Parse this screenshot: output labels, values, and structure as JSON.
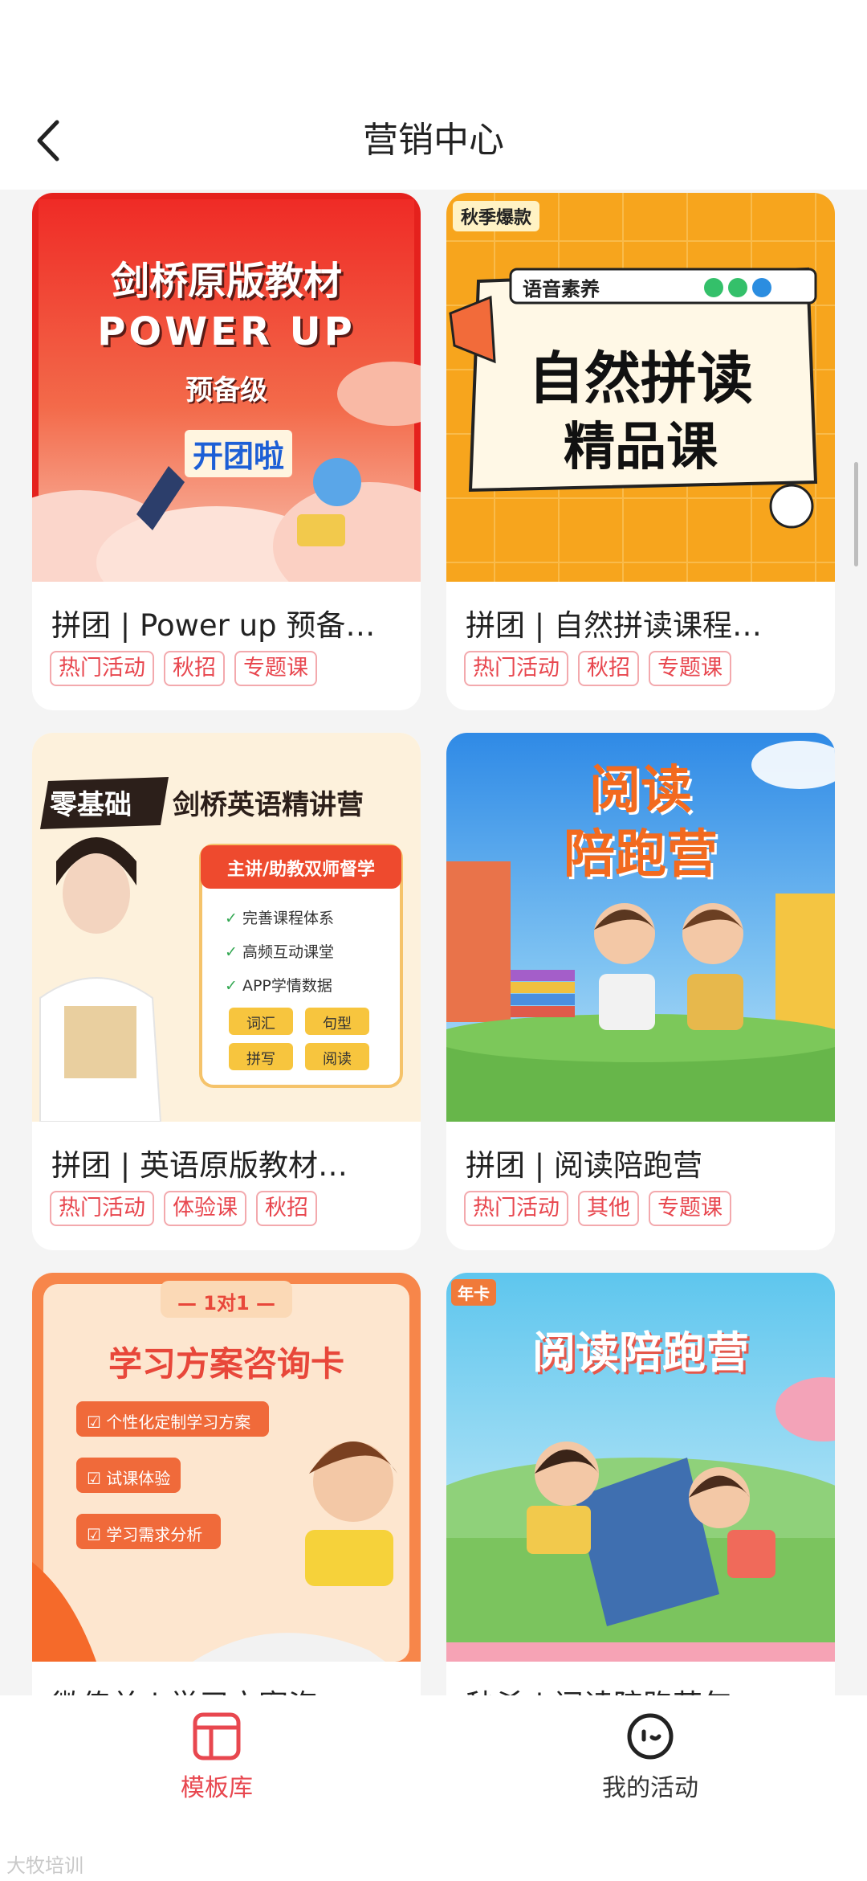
{
  "header": {
    "title": "营销中心"
  },
  "cards": [
    {
      "title": "拼团 | Power up 预备…",
      "tags": [
        "热门活动",
        "秋招",
        "专题课"
      ],
      "cover": {
        "line1": "剑桥原版教材",
        "line2": "POWER UP",
        "line3": "预备级",
        "badge": "开团啦"
      }
    },
    {
      "title": "拼团 | 自然拼读课程…",
      "tags": [
        "热门活动",
        "秋招",
        "专题课"
      ],
      "cover": {
        "corner": "秋季爆款",
        "subtitle": "语音素养",
        "line1": "自然拼读",
        "line2": "精品课"
      }
    },
    {
      "title": "拼团 | 英语原版教材…",
      "tags": [
        "热门活动",
        "体验课",
        "秋招"
      ],
      "cover": {
        "tag": "零基础",
        "line1": "剑桥英语精讲营",
        "panel_title": "主讲/助教双师督学",
        "checks": [
          "完善课程体系",
          "高频互动课堂",
          "APP学情数据"
        ],
        "pills": [
          "词汇",
          "句型",
          "拼写",
          "阅读"
        ]
      }
    },
    {
      "title": "拼团 | 阅读陪跑营",
      "tags": [
        "热门活动",
        "其他",
        "专题课"
      ],
      "cover": {
        "line1": "阅读",
        "line2": "陪跑营"
      }
    },
    {
      "title": "微传单 | 学习方案咨…",
      "tags": [],
      "cover": {
        "ribbon": "— 1对1 —",
        "line1": "学习方案咨询卡",
        "items": [
          "个性化定制学习方案",
          "试课体验",
          "学习需求分析"
        ]
      }
    },
    {
      "title": "秒杀 | 阅读陪跑营年…",
      "tags": [],
      "cover": {
        "corner": "年卡",
        "line1": "阅读陪跑营"
      }
    }
  ],
  "tabbar": {
    "library_label": "模板库",
    "mine_label": "我的活动"
  },
  "watermark": "大牧培训"
}
